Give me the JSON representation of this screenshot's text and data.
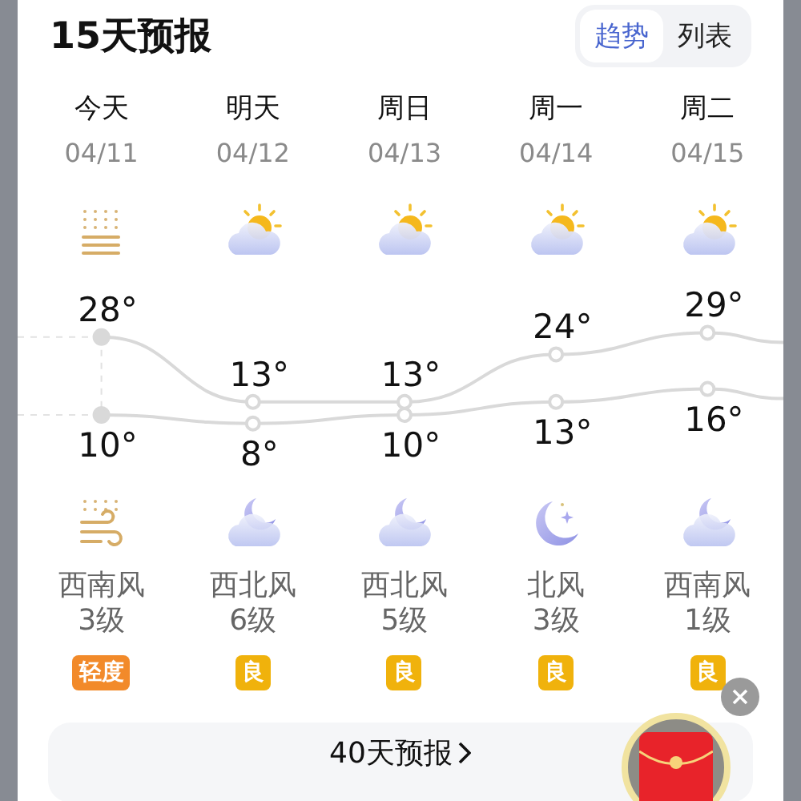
{
  "title": "15天预报",
  "tabs": [
    {
      "label": "趋势",
      "selected": true
    },
    {
      "label": "列表",
      "selected": false
    }
  ],
  "days": [
    {
      "name": "今天",
      "date": "04/11",
      "day_icon": {
        "kind": "haze"
      },
      "high": "28°",
      "low": "10°",
      "night_icon": {
        "kind": "haze_wind"
      },
      "wind": "西南风",
      "wind_level": "3级",
      "aqi": {
        "label": "轻度",
        "color": "#f28a2a"
      },
      "current": true
    },
    {
      "name": "明天",
      "date": "04/12",
      "day_icon": {
        "kind": "partly_cloudy"
      },
      "high": "13°",
      "low": "8°",
      "night_icon": {
        "kind": "cloudy_night"
      },
      "wind": "西北风",
      "wind_level": "6级",
      "aqi": {
        "label": "良",
        "color": "#f0b20c"
      },
      "current": false
    },
    {
      "name": "周日",
      "date": "04/13",
      "day_icon": {
        "kind": "partly_cloudy"
      },
      "high": "13°",
      "low": "10°",
      "night_icon": {
        "kind": "cloudy_night"
      },
      "wind": "西北风",
      "wind_level": "5级",
      "aqi": {
        "label": "良",
        "color": "#f0b20c"
      },
      "current": false
    },
    {
      "name": "周一",
      "date": "04/14",
      "day_icon": {
        "kind": "partly_cloudy"
      },
      "high": "24°",
      "low": "13°",
      "night_icon": {
        "kind": "clear_night"
      },
      "wind": "北风",
      "wind_level": "3级",
      "aqi": {
        "label": "良",
        "color": "#f0b20c"
      },
      "current": false
    },
    {
      "name": "周二",
      "date": "04/15",
      "day_icon": {
        "kind": "partly_cloudy"
      },
      "high": "29°",
      "low": "16°",
      "night_icon": {
        "kind": "cloudy_night"
      },
      "wind": "西南风",
      "wind_level": "1级",
      "aqi": {
        "label": "良",
        "color": "#f0b20c"
      },
      "current": false
    }
  ],
  "more_button": {
    "label": "40天预报"
  }
}
